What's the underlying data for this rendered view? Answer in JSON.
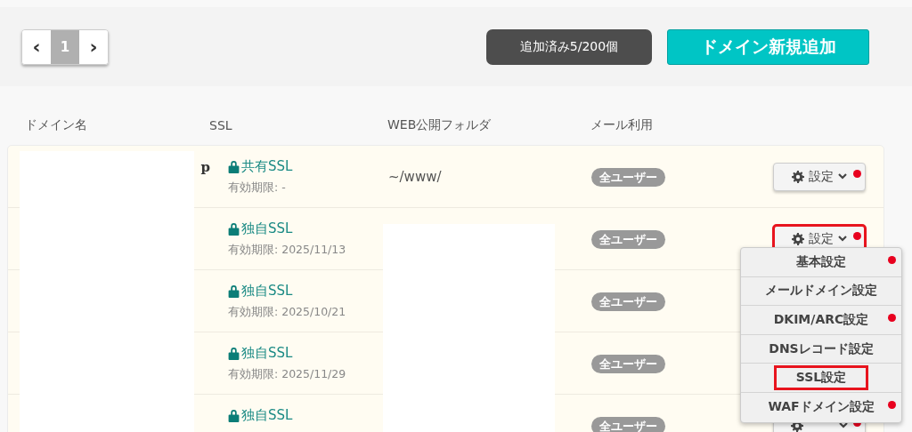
{
  "pagination": {
    "prev": "‹",
    "pages": [
      {
        "label": "1",
        "selected": true
      }
    ],
    "next": "›"
  },
  "toolbar": {
    "counter": "追加済み5/200個",
    "add_button": "ドメイン新規追加"
  },
  "table": {
    "columns": [
      "ドメイン名",
      "SSL",
      "WEB公開フォルダ",
      "メール利用"
    ],
    "rows": [
      {
        "domain": "p",
        "ssl": "共有SSL",
        "expiry": "有効期限: -",
        "folder": "~/www/",
        "mail": "全ユーザー",
        "settings": {
          "label": "設定",
          "dot": true,
          "highlighted": false
        }
      },
      {
        "ssl": "独自SSL",
        "expiry": "有効期限: 2025/11/13",
        "mail": "全ユーザー",
        "settings": {
          "label": "設定",
          "dot": true,
          "highlighted": true
        }
      },
      {
        "ssl": "独自SSL",
        "expiry": "有効期限: 2025/10/21",
        "mail": "全ユーザー"
      },
      {
        "ssl": "独自SSL",
        "expiry": "有効期限: 2025/11/29",
        "mail": "全ユーザー"
      },
      {
        "ssl": "独自SSL",
        "mail": "全ユーザー",
        "settings": {
          "dot": true,
          "highlighted": false
        }
      }
    ]
  },
  "settings_menu": {
    "items": [
      {
        "label": "基本設定",
        "dot": true,
        "highlighted": false
      },
      {
        "label": "メールドメイン設定",
        "dot": false,
        "highlighted": false
      },
      {
        "label": "DKIM/ARC設定",
        "dot": true,
        "highlighted": false
      },
      {
        "label": "DNSレコード設定",
        "dot": false,
        "highlighted": false
      },
      {
        "label": "SSL設定",
        "dot": false,
        "highlighted": true
      },
      {
        "label": "WAFドメイン設定",
        "dot": true,
        "highlighted": false
      }
    ]
  }
}
